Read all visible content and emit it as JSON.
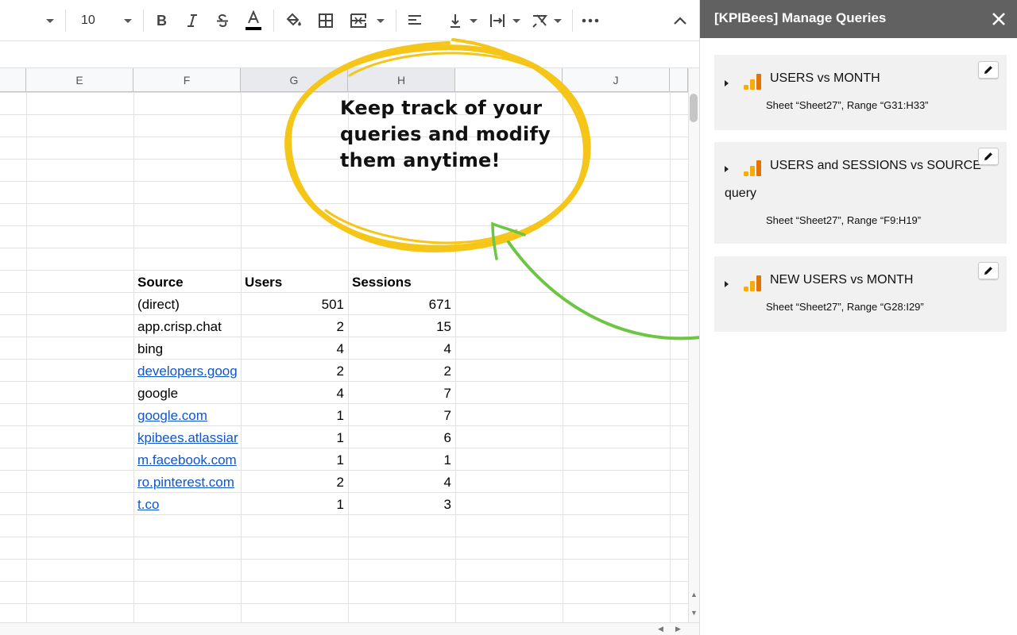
{
  "toolbar": {
    "font_size": "10",
    "icons": [
      "caret-down-icon",
      "bold-icon",
      "italic-icon",
      "strikethrough-icon",
      "text-color-icon",
      "fill-color-icon",
      "borders-icon",
      "merge-cells-icon",
      "align-left-icon",
      "vertical-align-icon",
      "text-wrap-icon",
      "text-rotation-icon",
      "more-icon",
      "collapse-icon"
    ]
  },
  "grid": {
    "columns": [
      "E",
      "F",
      "G",
      "H",
      "J"
    ],
    "headers": {
      "source": "Source",
      "users": "Users",
      "sessions": "Sessions"
    },
    "rows": [
      {
        "source": "(direct)",
        "users": "501",
        "sessions": "671",
        "link": false
      },
      {
        "source": "app.crisp.chat",
        "users": "2",
        "sessions": "15",
        "link": false
      },
      {
        "source": "bing",
        "users": "4",
        "sessions": "4",
        "link": false
      },
      {
        "source": "developers.goog",
        "users": "2",
        "sessions": "2",
        "link": true
      },
      {
        "source": "google",
        "users": "4",
        "sessions": "7",
        "link": false
      },
      {
        "source": "google.com",
        "users": "1",
        "sessions": "7",
        "link": true
      },
      {
        "source": "kpibees.atlassiar",
        "users": "1",
        "sessions": "6",
        "link": true
      },
      {
        "source": "m.facebook.com",
        "users": "1",
        "sessions": "1",
        "link": true
      },
      {
        "source": "ro.pinterest.com",
        "users": "2",
        "sessions": "4",
        "link": true
      },
      {
        "source": "t.co",
        "users": "1",
        "sessions": "3",
        "link": true
      }
    ]
  },
  "callout": {
    "line1": "Keep track of your",
    "line2": "queries and modify",
    "line3": "them anytime!",
    "circle_color": "#f5c518",
    "arrow_color": "#6cc644"
  },
  "sidebar": {
    "title": "[KPIBees] Manage Queries",
    "queries": [
      {
        "title": "USERS vs MONTH",
        "title2": "",
        "meta": "Sheet “Sheet27”, Range “G31:H33”"
      },
      {
        "title": "USERS and SESSIONS vs SOURCE",
        "title2": "query",
        "meta": "Sheet “Sheet27”, Range “F9:H19”"
      },
      {
        "title": "NEW USERS vs MONTH",
        "title2": "",
        "meta": "Sheet “Sheet27”, Range “G28:I29”"
      }
    ],
    "header_color": "#616161",
    "card_color": "#f1f1f1",
    "logo_colors": [
      "#f9ab00",
      "#e37400"
    ]
  }
}
